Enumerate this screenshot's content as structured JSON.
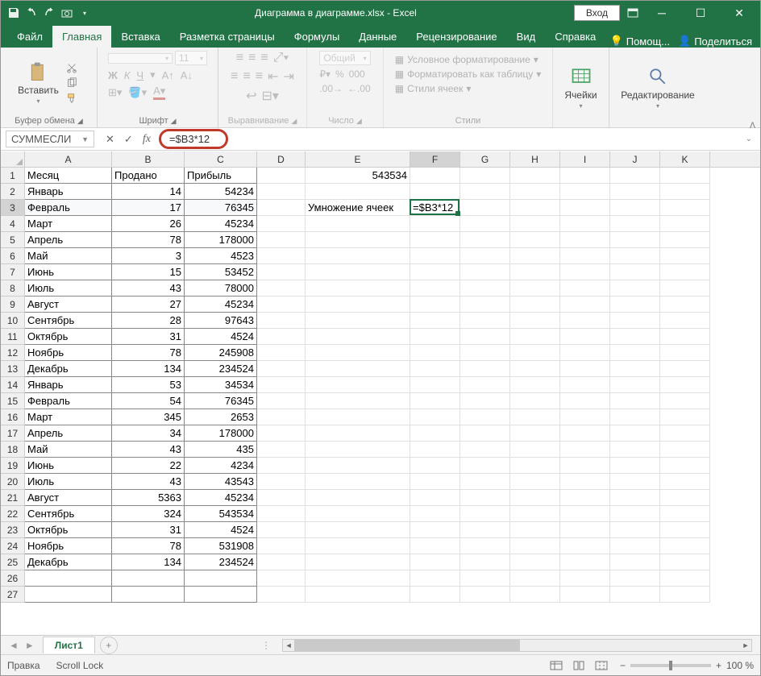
{
  "title": "Диаграмма в диаграмме.xlsx - Excel",
  "qat": {
    "login": "Вход"
  },
  "tabs": {
    "file": "Файл",
    "home": "Главная",
    "insert": "Вставка",
    "layout": "Разметка страницы",
    "formulas": "Формулы",
    "data": "Данные",
    "review": "Рецензирование",
    "view": "Вид",
    "help": "Справка",
    "assist": "Помощ...",
    "share": "Поделиться"
  },
  "ribbon": {
    "paste": "Вставить",
    "clipboard": "Буфер обмена",
    "font": "Шрифт",
    "align": "Выравнивание",
    "number": "Число",
    "styles": "Стили",
    "cells": "Ячейки",
    "editing": "Редактирование",
    "font_name": "",
    "font_size": "11",
    "num_format": "Общий",
    "cond_fmt": "Условное форматирование",
    "as_table": "Форматировать как таблицу",
    "cell_styles": "Стили ячеек"
  },
  "namebox": "СУММЕСЛИ",
  "formula": "=$B3*12",
  "columns": [
    "A",
    "B",
    "C",
    "D",
    "E",
    "F",
    "G",
    "H",
    "I",
    "J",
    "K"
  ],
  "headers": {
    "A": "Месяц",
    "B": "Продано",
    "C": "Прибыль"
  },
  "e1": "543534",
  "e3": "Умножение ячеек",
  "f3": "=$B3*12",
  "table": [
    {
      "m": "Январь",
      "s": 14,
      "p": 54234
    },
    {
      "m": "Февраль",
      "s": 17,
      "p": 76345
    },
    {
      "m": "Март",
      "s": 26,
      "p": 45234
    },
    {
      "m": "Апрель",
      "s": 78,
      "p": 178000
    },
    {
      "m": "Май",
      "s": 3,
      "p": 4523
    },
    {
      "m": "Июнь",
      "s": 15,
      "p": 53452
    },
    {
      "m": "Июль",
      "s": 43,
      "p": 78000
    },
    {
      "m": "Август",
      "s": 27,
      "p": 45234
    },
    {
      "m": "Сентябрь",
      "s": 28,
      "p": 97643
    },
    {
      "m": "Октябрь",
      "s": 31,
      "p": 4524
    },
    {
      "m": "Ноябрь",
      "s": 78,
      "p": 245908
    },
    {
      "m": "Декабрь",
      "s": 134,
      "p": 234524
    },
    {
      "m": "Январь",
      "s": 53,
      "p": 34534
    },
    {
      "m": "Февраль",
      "s": 54,
      "p": 76345
    },
    {
      "m": "Март",
      "s": 345,
      "p": 2653
    },
    {
      "m": "Апрель",
      "s": 34,
      "p": 178000
    },
    {
      "m": "Май",
      "s": 43,
      "p": 435
    },
    {
      "m": "Июнь",
      "s": 22,
      "p": 4234
    },
    {
      "m": "Июль",
      "s": 43,
      "p": 43543
    },
    {
      "m": "Август",
      "s": 5363,
      "p": 45234
    },
    {
      "m": "Сентябрь",
      "s": 324,
      "p": 543534
    },
    {
      "m": "Октябрь",
      "s": 31,
      "p": 4524
    },
    {
      "m": "Ноябрь",
      "s": 78,
      "p": 531908
    },
    {
      "m": "Декабрь",
      "s": 134,
      "p": 234524
    }
  ],
  "sheet": "Лист1",
  "status": {
    "mode": "Правка",
    "scroll": "Scroll Lock",
    "zoom": "100 %"
  }
}
